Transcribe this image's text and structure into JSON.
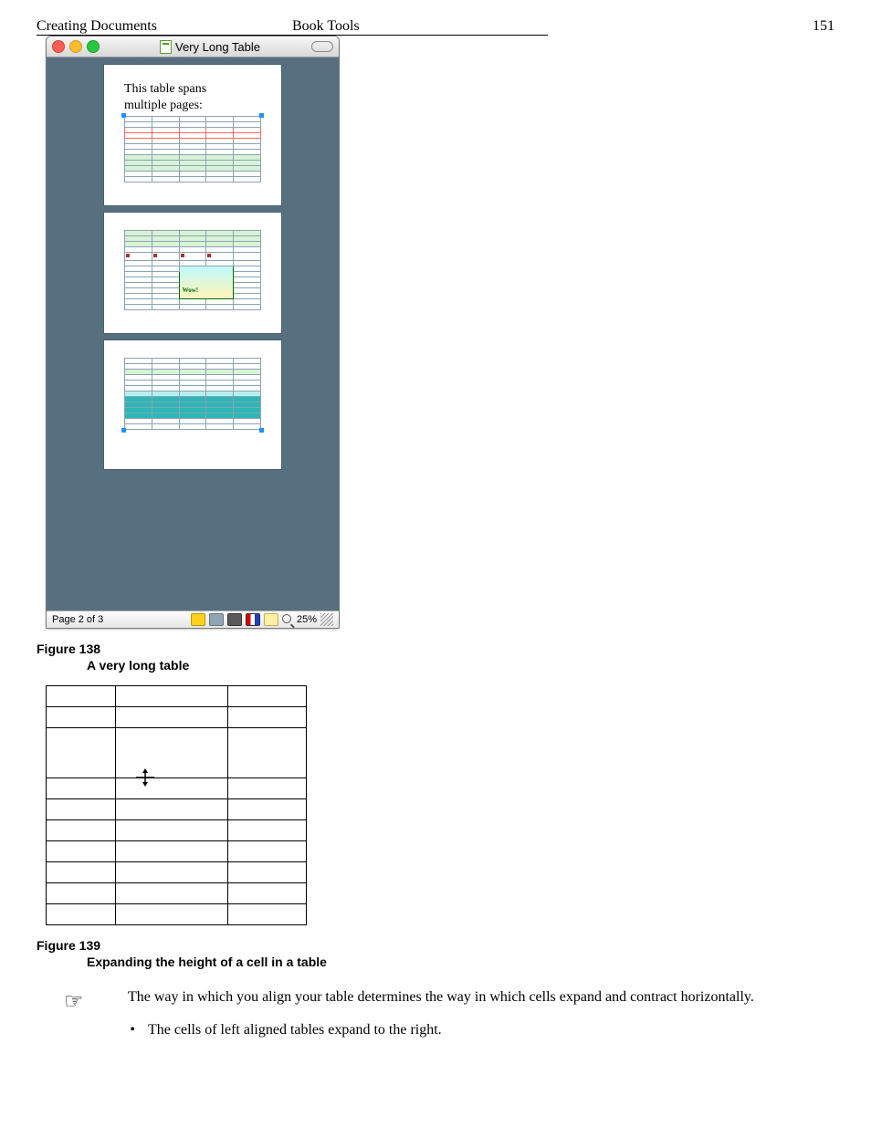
{
  "header": {
    "left": "Creating Documents",
    "center": "Book Tools",
    "page_number": "151"
  },
  "window": {
    "title": "Very Long Table",
    "thumb_heading1": "This table spans",
    "thumb_heading2": "multiple pages:",
    "wow_label": "Wow!",
    "status_page": "Page 2 of 3",
    "status_zoom": "25%"
  },
  "fig138": {
    "num": "Figure 138",
    "title": "A very long table"
  },
  "fig139": {
    "num": "Figure 139",
    "title": "Expanding the height of a cell in a table"
  },
  "note": {
    "text": "The way in which you align your table determines the way in which cells expand and contract horizontally."
  },
  "bullet": {
    "text": "The cells of left aligned tables expand to the right."
  }
}
